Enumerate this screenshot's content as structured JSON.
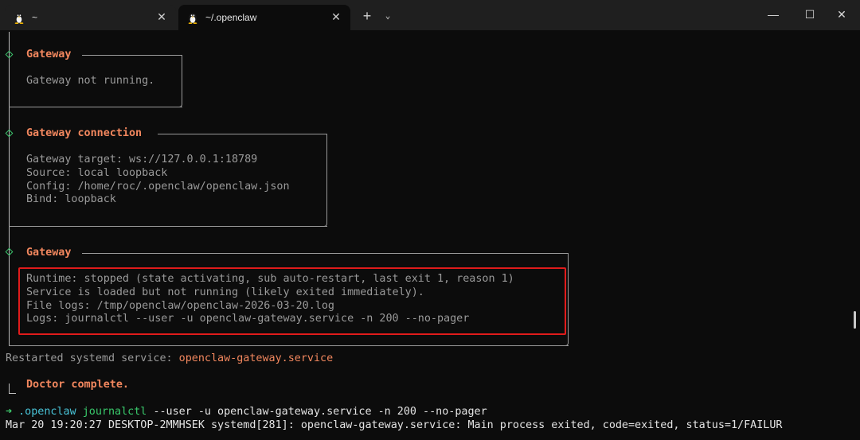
{
  "tabs": [
    {
      "label": "~",
      "close": "✕"
    },
    {
      "label": "~/.openclaw",
      "close": "✕"
    }
  ],
  "titlebar": {
    "new_tab": "+",
    "dropdown": "⌄",
    "minimize": "—",
    "maximize": "☐",
    "close": "✕"
  },
  "sections": [
    {
      "title": "Gateway",
      "lines": [
        "Gateway not running."
      ]
    },
    {
      "title": "Gateway connection",
      "lines": [
        "Gateway target: ws://127.0.0.1:18789",
        "Source: local loopback",
        "Config: /home/roc/.openclaw/openclaw.json",
        "Bind: loopback"
      ]
    },
    {
      "title": "Gateway",
      "lines": [
        "Runtime: stopped (state activating, sub auto-restart, last exit 1, reason 1)",
        "Service is loaded but not running (likely exited immediately).",
        "File logs: /tmp/openclaw/openclaw-2026-03-20.log",
        "Logs: journalctl --user -u openclaw-gateway.service -n 200 --no-pager"
      ]
    }
  ],
  "restarted": {
    "prefix": "Restarted systemd service: ",
    "service": "openclaw-gateway.service"
  },
  "doctor": "Doctor complete.",
  "prompt": {
    "arrow": "➜",
    "dir": ".openclaw",
    "cmd": "journalctl",
    "args": "--user -u openclaw-gateway.service -n 200 --no-pager"
  },
  "output_line": "Mar 20 19:20:27 DESKTOP-2MMHSEK systemd[281]: openclaw-gateway.service: Main process exited, code=exited, status=1/FAILUR",
  "colors": {
    "accent_orange": "#f2875e",
    "prompt_green": "#3fd06f",
    "dir_cyan": "#49c4d8",
    "highlight_red": "#e01b1b",
    "background": "#0c0c0c"
  }
}
